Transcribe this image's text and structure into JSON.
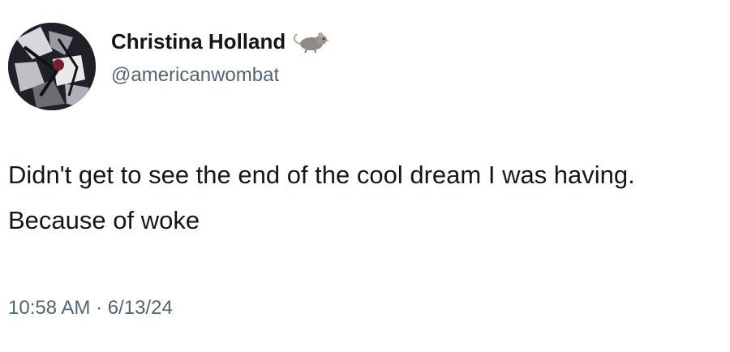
{
  "author": {
    "display_name": "Christina Holland",
    "handle": "@americanwombat",
    "name_emoji_icon": "rat-icon",
    "avatar_icon": "avatar-icon"
  },
  "tweet": {
    "text": "Didn't get to see the end of the cool dream I was having. Because of woke",
    "time": "10:58 AM",
    "separator": "·",
    "date": "6/13/24"
  },
  "colors": {
    "text_primary": "#14171a",
    "text_secondary": "#536471",
    "background": "#ffffff"
  }
}
